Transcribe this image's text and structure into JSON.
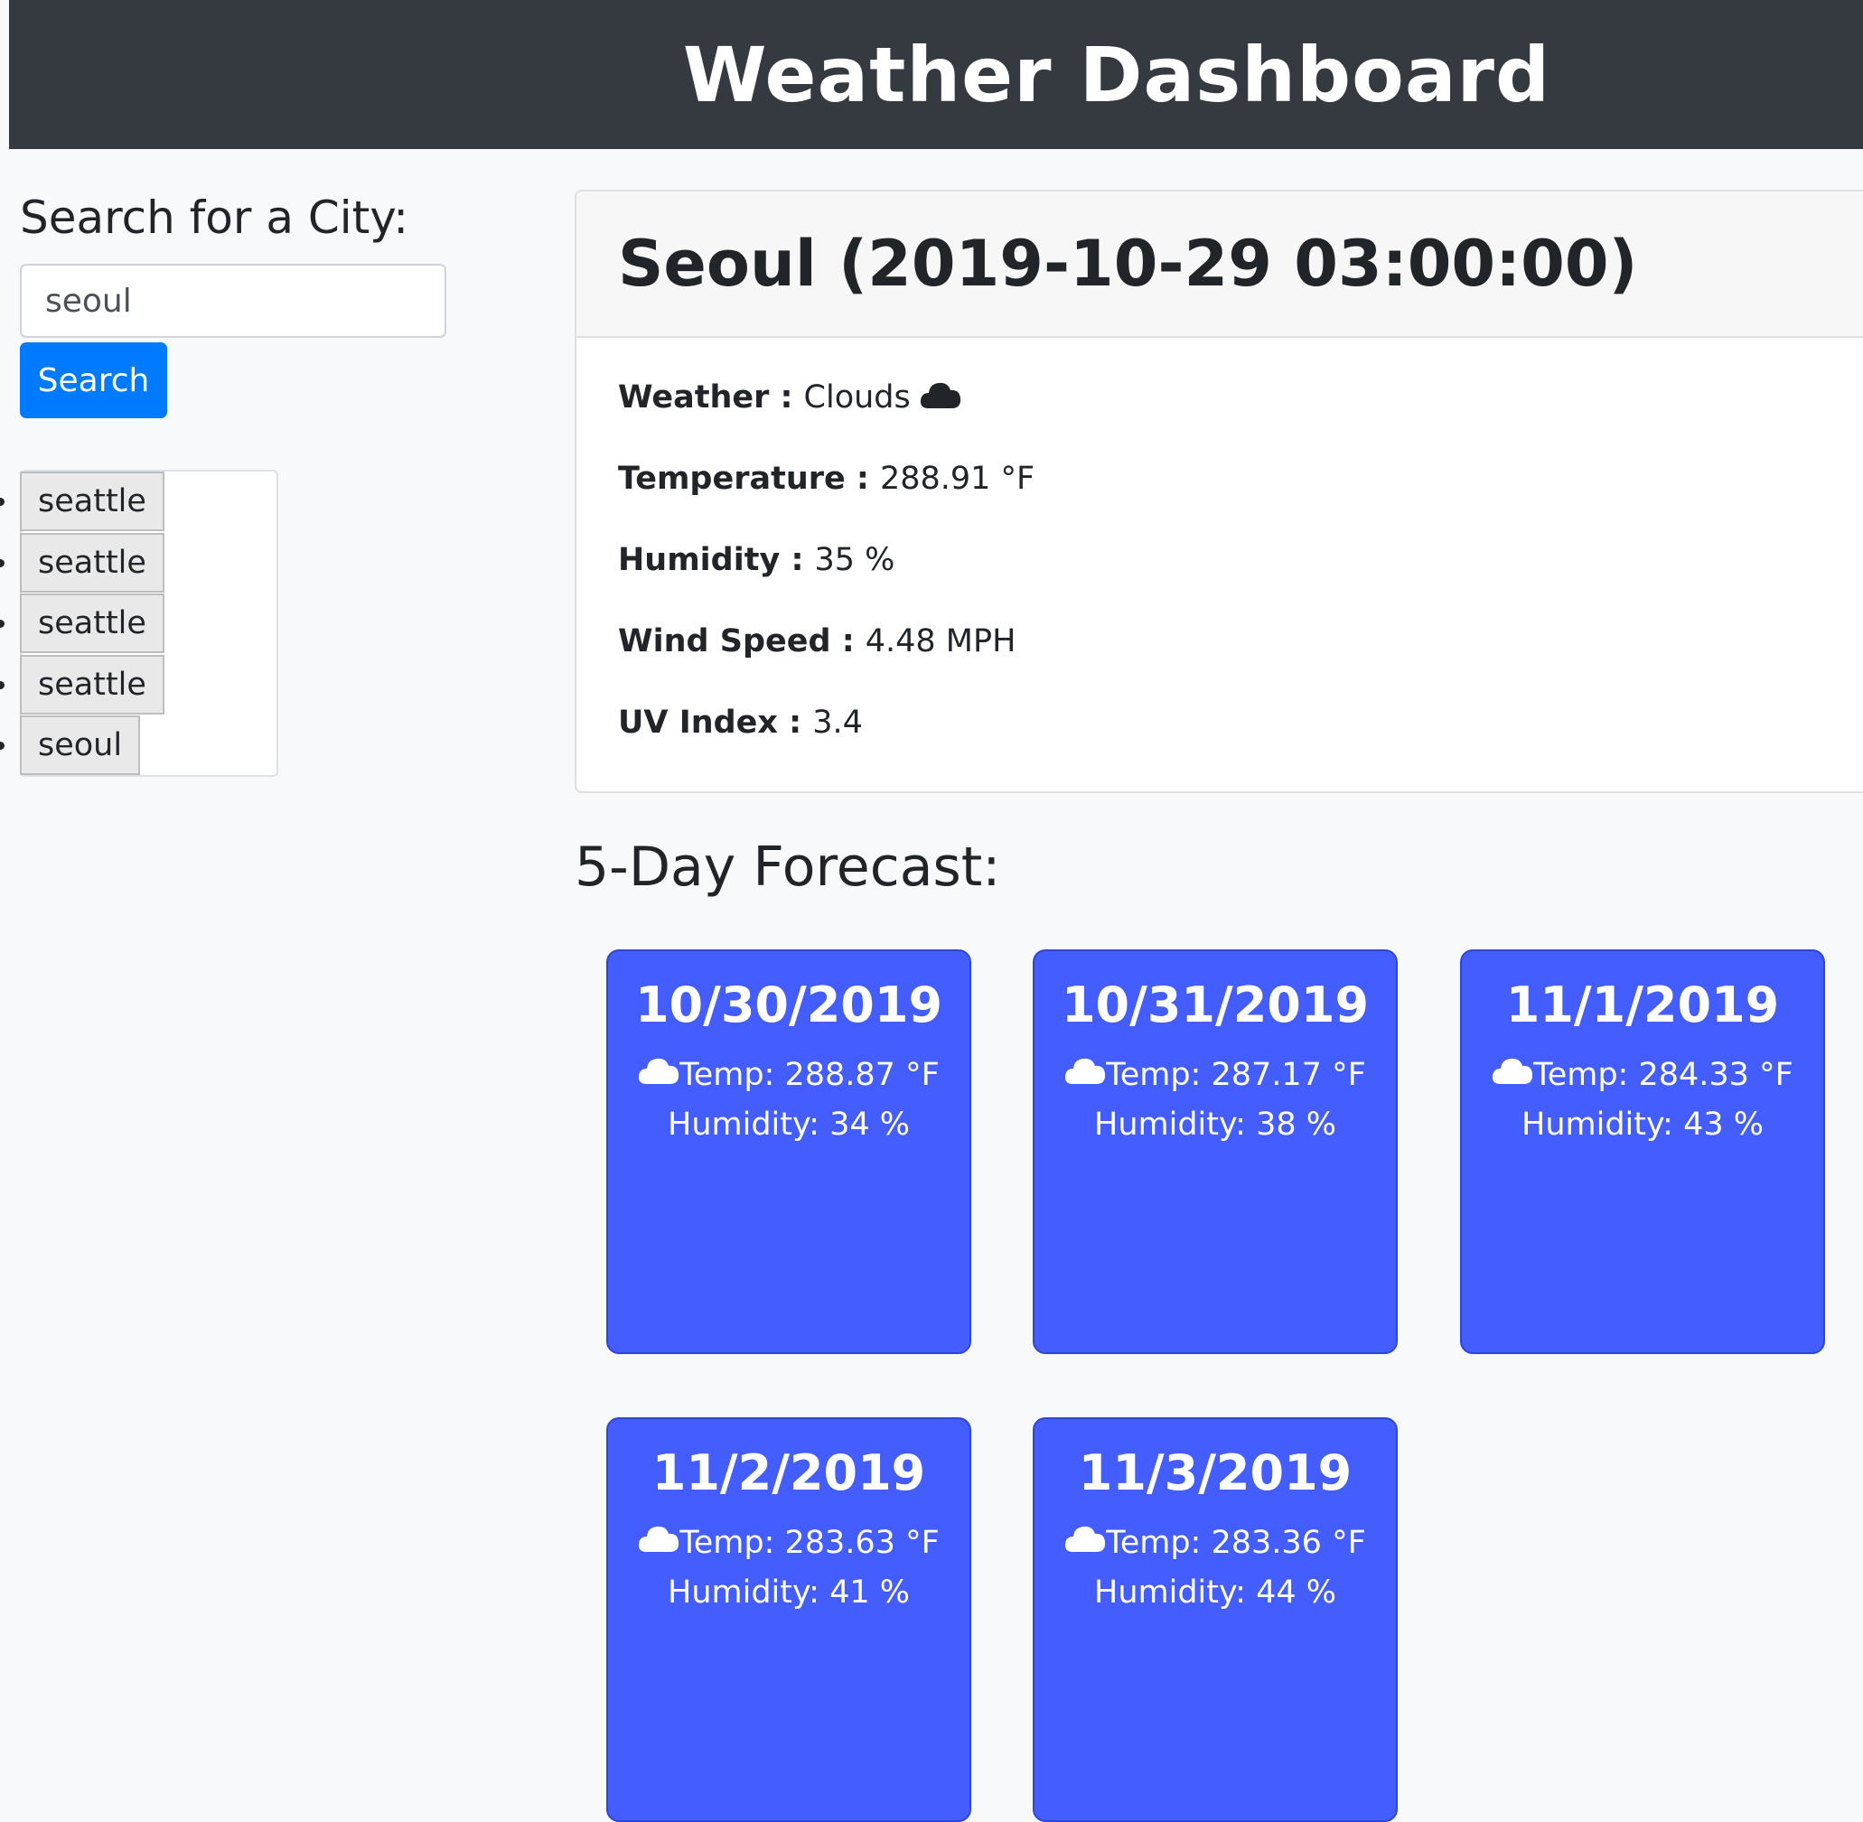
{
  "header": {
    "title": "Weather Dashboard"
  },
  "sidebar": {
    "heading": "Search for a City:",
    "search_value": "seoul",
    "search_button": "Search",
    "history": [
      {
        "label": "seattle"
      },
      {
        "label": "seattle"
      },
      {
        "label": "seattle"
      },
      {
        "label": "seattle"
      },
      {
        "label": "seoul"
      }
    ]
  },
  "current": {
    "title": "Seoul (2019-10-29 03:00:00)",
    "weather": {
      "label": "Weather :",
      "value": "Clouds",
      "icon": "cloud-icon"
    },
    "temperature": {
      "label": "Temperature :",
      "value": "288.91 °F"
    },
    "humidity": {
      "label": "Humidity :",
      "value": "35 %"
    },
    "wind": {
      "label": "Wind Speed :",
      "value": "4.48 MPH"
    },
    "uv": {
      "label": "UV Index :",
      "value": "3.4"
    }
  },
  "forecast": {
    "title": "5-Day Forecast:",
    "days": [
      {
        "date": "10/30/2019",
        "temp": "Temp: 288.87 °F",
        "humidity": "Humidity: 34 %"
      },
      {
        "date": "10/31/2019",
        "temp": "Temp: 287.17 °F",
        "humidity": "Humidity: 38 %"
      },
      {
        "date": "11/1/2019",
        "temp": "Temp: 284.33 °F",
        "humidity": "Humidity: 43 %"
      },
      {
        "date": "11/2/2019",
        "temp": "Temp: 283.63 °F",
        "humidity": "Humidity: 41 %"
      },
      {
        "date": "11/3/2019",
        "temp": "Temp: 283.36 °F",
        "humidity": "Humidity: 44 %"
      }
    ]
  },
  "colors": {
    "header_bg": "#343a40",
    "accent": "#007bff",
    "card_bg": "#435dff",
    "page_bg": "#f8f9fa"
  }
}
